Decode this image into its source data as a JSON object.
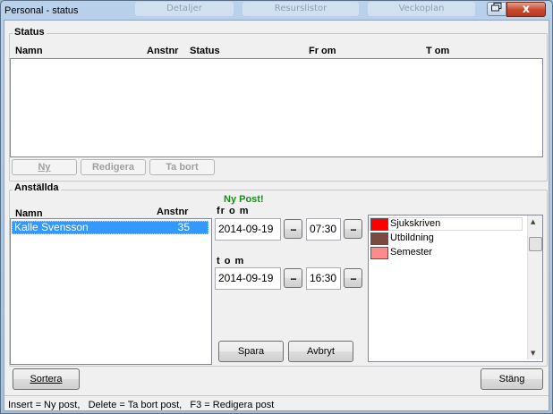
{
  "window": {
    "title": "Personal - status",
    "background_tabs": [
      "Detaljer",
      "Resurslistor",
      "Veckoplan"
    ],
    "restore_icon": "restore-icon",
    "close_label": "x"
  },
  "status": {
    "title": "Status",
    "columns": [
      "Namn",
      "Anstnr",
      "Status",
      "Fr om",
      "T om"
    ],
    "rows": [],
    "buttons": {
      "new": "Ny",
      "edit": "Redigera",
      "delete": "Ta bort"
    }
  },
  "anstallda": {
    "title": "Anställda",
    "columns": [
      "Namn",
      "Anstnr"
    ],
    "rows": [
      {
        "name": "Kalle Svensson",
        "number": "35",
        "selected": true
      }
    ],
    "new_post_label": "Ny Post!",
    "new_post_color": "#1a8c1a",
    "from_label": "fr o m",
    "to_label": "t o m",
    "from_date": "2014-09-19",
    "from_time": "07:30",
    "to_date": "2014-09-19",
    "to_time": "16:30",
    "picker_label": "...",
    "save": "Spara",
    "cancel": "Avbryt",
    "status_types": [
      {
        "label": "Sjukskriven",
        "color": "#ff0000"
      },
      {
        "label": "Utbildning",
        "color": "#7a4a42"
      },
      {
        "label": "Semester",
        "color": "#ff8a8a"
      }
    ]
  },
  "footer": {
    "sort": "Sortera",
    "close": "Stäng",
    "status_bar": "Insert = Ny post,   Delete = Ta bort post,   F3 = Redigera post"
  },
  "colors": {
    "selection": "#3399ff",
    "accent_close": "#c7452c"
  }
}
